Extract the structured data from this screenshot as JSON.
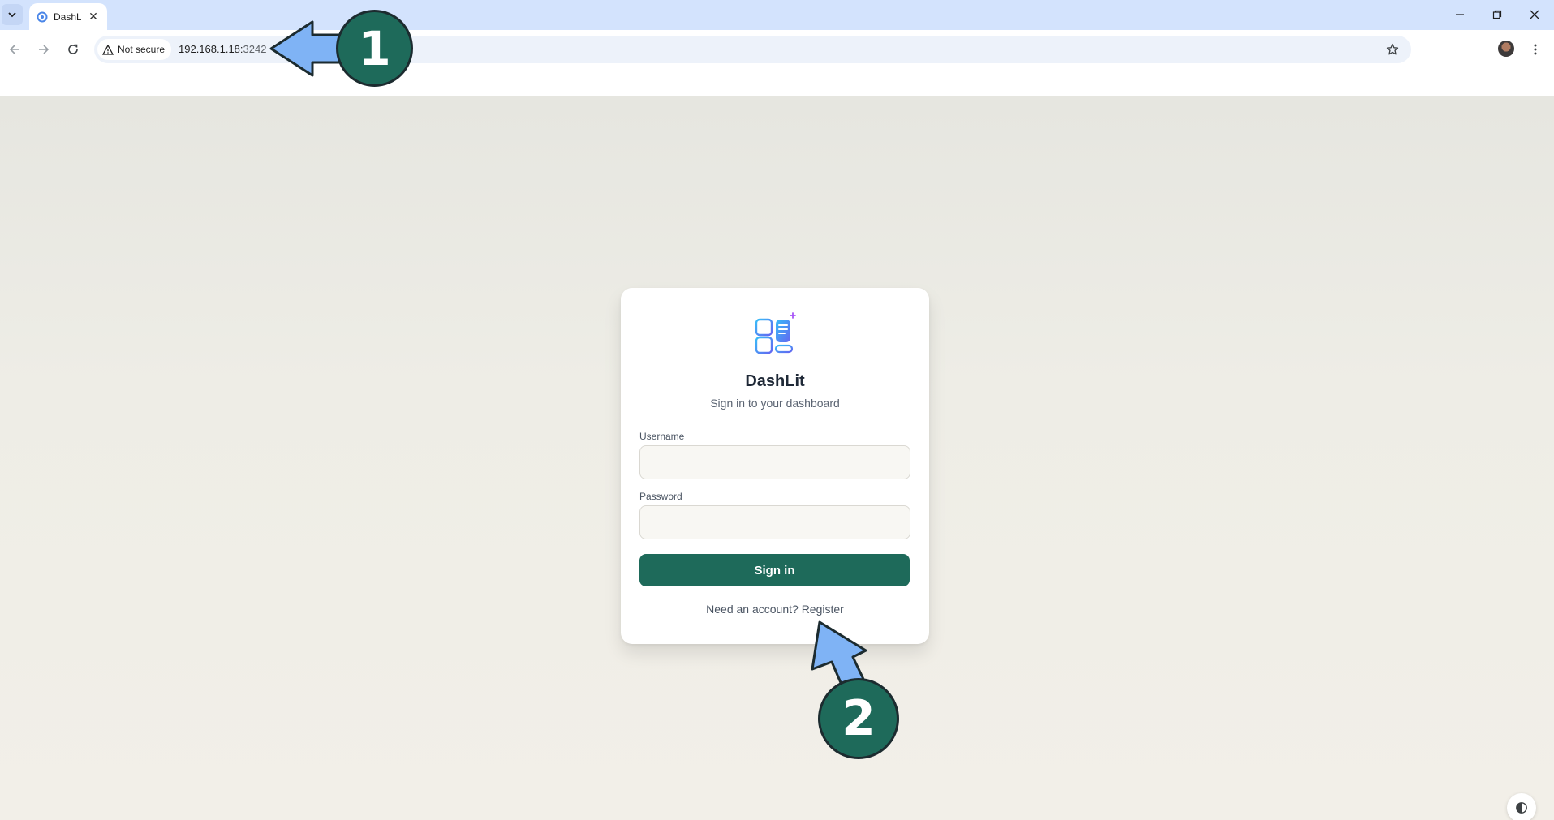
{
  "browser": {
    "tab": {
      "title": "DashLit",
      "close_glyph": "✕",
      "favicon": "dashlit-favicon-icon"
    },
    "window_controls": [
      "minimize-icon",
      "restore-icon",
      "close-icon"
    ],
    "address_bar": {
      "security_label": "Not secure",
      "url_host": "192.168.1.18:",
      "url_port": "3242"
    }
  },
  "login_card": {
    "logo": "dashlit-logo-icon",
    "title": "DashLit",
    "subtitle": "Sign in to your dashboard",
    "username_label": "Username",
    "username_value": "",
    "password_label": "Password",
    "password_value": "",
    "submit_label": "Sign in",
    "register_prompt": "Need an account?",
    "register_link": "Register"
  },
  "annotations": {
    "step_1": "1",
    "step_2": "2",
    "colors": {
      "arrow_fill": "#7fb3f5",
      "arrow_stroke": "#1c2b2f",
      "badge_fill": "#1e6a5a"
    }
  },
  "colors": {
    "accent": "#1e6a5a",
    "tabstrip": "#d3e3fd"
  }
}
